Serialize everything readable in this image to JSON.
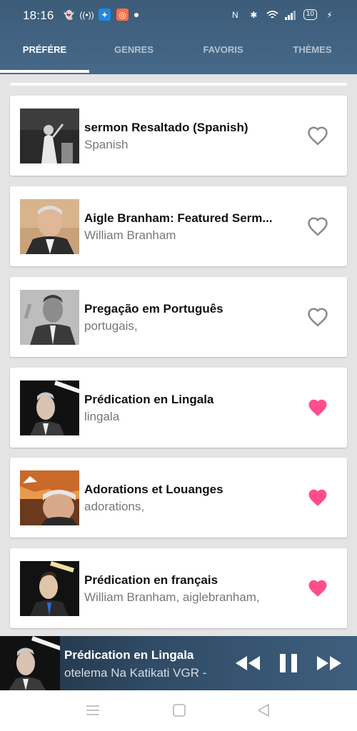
{
  "status_bar": {
    "time": "18:16",
    "battery": "10"
  },
  "tabs": [
    {
      "label": "PRÉFÉRE",
      "active": true
    },
    {
      "label": "GENRES",
      "active": false
    },
    {
      "label": "FAVORIS",
      "active": false
    },
    {
      "label": "THÈMES",
      "active": false
    }
  ],
  "items": [
    {
      "title": "sermon Resaltado (Spanish)",
      "subtitle": "Spanish",
      "favorite": false,
      "icon": "heart-outline-icon"
    },
    {
      "title": "Aigle Branham: Featured Serm...",
      "subtitle": "William Branham",
      "favorite": false,
      "icon": "heart-outline-icon"
    },
    {
      "title": "Pregação em Português",
      "subtitle": "portugais,",
      "favorite": false,
      "icon": "heart-outline-icon"
    },
    {
      "title": "Prédication en Lingala",
      "subtitle": "lingala",
      "favorite": true,
      "icon": "heart-filled-icon"
    },
    {
      "title": "Adorations et Louanges",
      "subtitle": "adorations,",
      "favorite": true,
      "icon": "heart-filled-icon"
    },
    {
      "title": "Prédication en français",
      "subtitle": "William Branham, aiglebranham,",
      "favorite": true,
      "icon": "heart-filled-icon"
    }
  ],
  "player": {
    "title": "Prédication en Lingala",
    "subtitle": "otelema Na Katikati VGR -"
  },
  "colors": {
    "header": "#46698a",
    "favorite": "#ff4d8d",
    "heart_outline": "#8a8a8a"
  }
}
